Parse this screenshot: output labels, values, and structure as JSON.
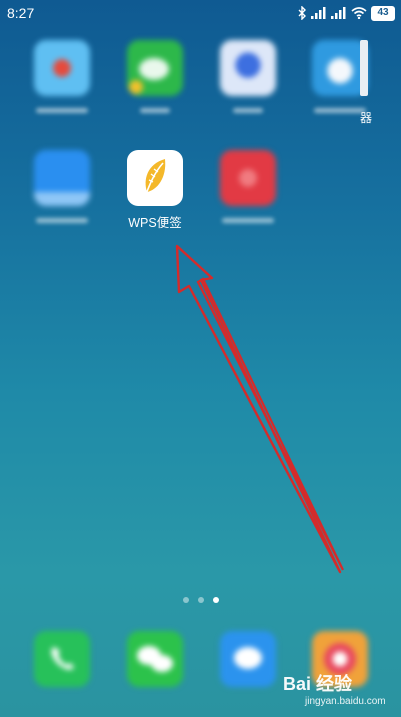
{
  "status_bar": {
    "time": "8:27",
    "battery": "43"
  },
  "home": {
    "apps_row1": [
      {
        "name": "blurred-app-1",
        "color": "#3aa5e8"
      },
      {
        "name": "blurred-app-2",
        "color": "#2db84a"
      },
      {
        "name": "blurred-app-3",
        "color": "#4e8fe6"
      },
      {
        "name": "blurred-app-4",
        "color": "#2f9ae0"
      }
    ],
    "edge_label": "器",
    "wps_app": {
      "label": "WPS便签",
      "icon": "feather-icon",
      "accent": "#f4b82a"
    },
    "apps_row2_blurred": [
      {
        "name": "blurred-app-5",
        "color": "#2a8ff0"
      },
      {
        "name": "blurred-app-7",
        "color": "#e23a44"
      }
    ],
    "page_indicator": {
      "count": 3,
      "active": 3
    }
  },
  "dock": {
    "apps": [
      {
        "name": "phone-icon",
        "color": "#27c15a"
      },
      {
        "name": "wechat-icon",
        "color": "#2cc24b"
      },
      {
        "name": "messages-icon",
        "color": "#2b93ee"
      },
      {
        "name": "browser-icon",
        "color": "#f0a23a"
      }
    ]
  },
  "watermark": {
    "brand": "Bai 经验",
    "url": "jingyan.baidu.com"
  },
  "annotation": {
    "arrow_color": "#d42b2b"
  }
}
